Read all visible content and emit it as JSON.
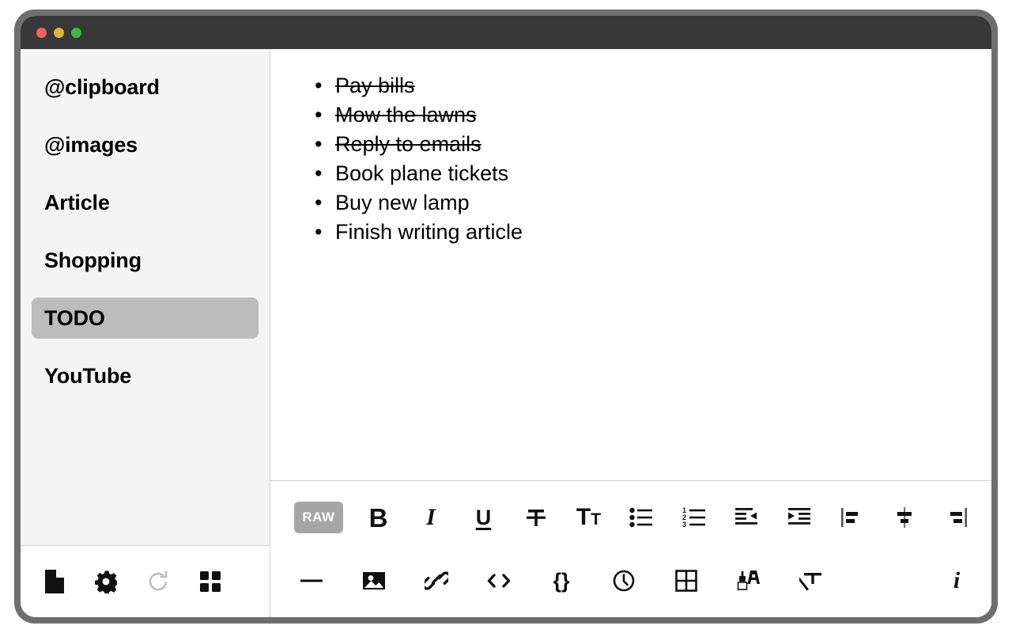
{
  "window": {
    "traffic_lights": [
      {
        "name": "close",
        "color": "#f3625a"
      },
      {
        "name": "minimize",
        "color": "#e0b23a"
      },
      {
        "name": "zoom",
        "color": "#3cb944"
      }
    ]
  },
  "sidebar": {
    "items": [
      {
        "label": "@clipboard",
        "active": false
      },
      {
        "label": "@images",
        "active": false
      },
      {
        "label": "Article",
        "active": false
      },
      {
        "label": "Shopping",
        "active": false
      },
      {
        "label": "TODO",
        "active": true
      },
      {
        "label": "YouTube",
        "active": false
      }
    ],
    "footer_icons": [
      {
        "name": "new-document-icon",
        "label": "New note",
        "state": "enabled"
      },
      {
        "name": "gear-icon",
        "label": "Settings",
        "state": "enabled"
      },
      {
        "name": "refresh-icon",
        "label": "Sync",
        "state": "disabled"
      },
      {
        "name": "grid-icon",
        "label": "All notes",
        "state": "enabled"
      }
    ]
  },
  "editor": {
    "note_title": "TODO",
    "list_type": "bullet",
    "items": [
      {
        "text": "Pay bills",
        "done": true
      },
      {
        "text": "Mow the lawns",
        "done": true
      },
      {
        "text": "Reply to emails",
        "done": true
      },
      {
        "text": "Book plane tickets",
        "done": false
      },
      {
        "text": "Buy new lamp",
        "done": false
      },
      {
        "text": "Finish writing article",
        "done": false
      }
    ]
  },
  "toolbar": {
    "raw_label": "RAW",
    "bold_label": "B",
    "italic_label": "I",
    "underline_label": "U",
    "row1": [
      {
        "name": "raw-toggle",
        "label": "RAW"
      },
      {
        "name": "bold-button",
        "label": "Bold"
      },
      {
        "name": "italic-button",
        "label": "Italic"
      },
      {
        "name": "underline-button",
        "label": "Underline"
      },
      {
        "name": "strikethrough-button",
        "label": "Strikethrough"
      },
      {
        "name": "font-size-button",
        "label": "Font size"
      },
      {
        "name": "bulleted-list-button",
        "label": "Bulleted list"
      },
      {
        "name": "numbered-list-button",
        "label": "Numbered list"
      },
      {
        "name": "outdent-button",
        "label": "Decrease indent"
      },
      {
        "name": "indent-button",
        "label": "Increase indent"
      },
      {
        "name": "align-left-button",
        "label": "Align left"
      },
      {
        "name": "align-center-button",
        "label": "Align center"
      },
      {
        "name": "align-right-button",
        "label": "Align right"
      }
    ],
    "row2": [
      {
        "name": "horizontal-rule-button",
        "label": "Horizontal rule"
      },
      {
        "name": "image-button",
        "label": "Insert image"
      },
      {
        "name": "link-button",
        "label": "Insert link"
      },
      {
        "name": "code-button",
        "label": "Inline code"
      },
      {
        "name": "code-block-button",
        "label": "Code block"
      },
      {
        "name": "timestamp-button",
        "label": "Insert timestamp"
      },
      {
        "name": "table-button",
        "label": "Insert table"
      },
      {
        "name": "text-color-button",
        "label": "Text color"
      },
      {
        "name": "clear-formatting-button",
        "label": "Clear formatting"
      },
      {
        "name": "info-button",
        "label": "Info"
      }
    ]
  },
  "colors": {
    "window_frame": "#6e6e6e",
    "titlebar": "#383838",
    "sidebar_bg": "#f4f4f4",
    "active_item_bg": "#bcbcbc",
    "raw_badge_bg": "#a6a6a6",
    "divider": "#cfcfcf",
    "text": "#000000",
    "disabled_icon": "#bdbdbd"
  }
}
